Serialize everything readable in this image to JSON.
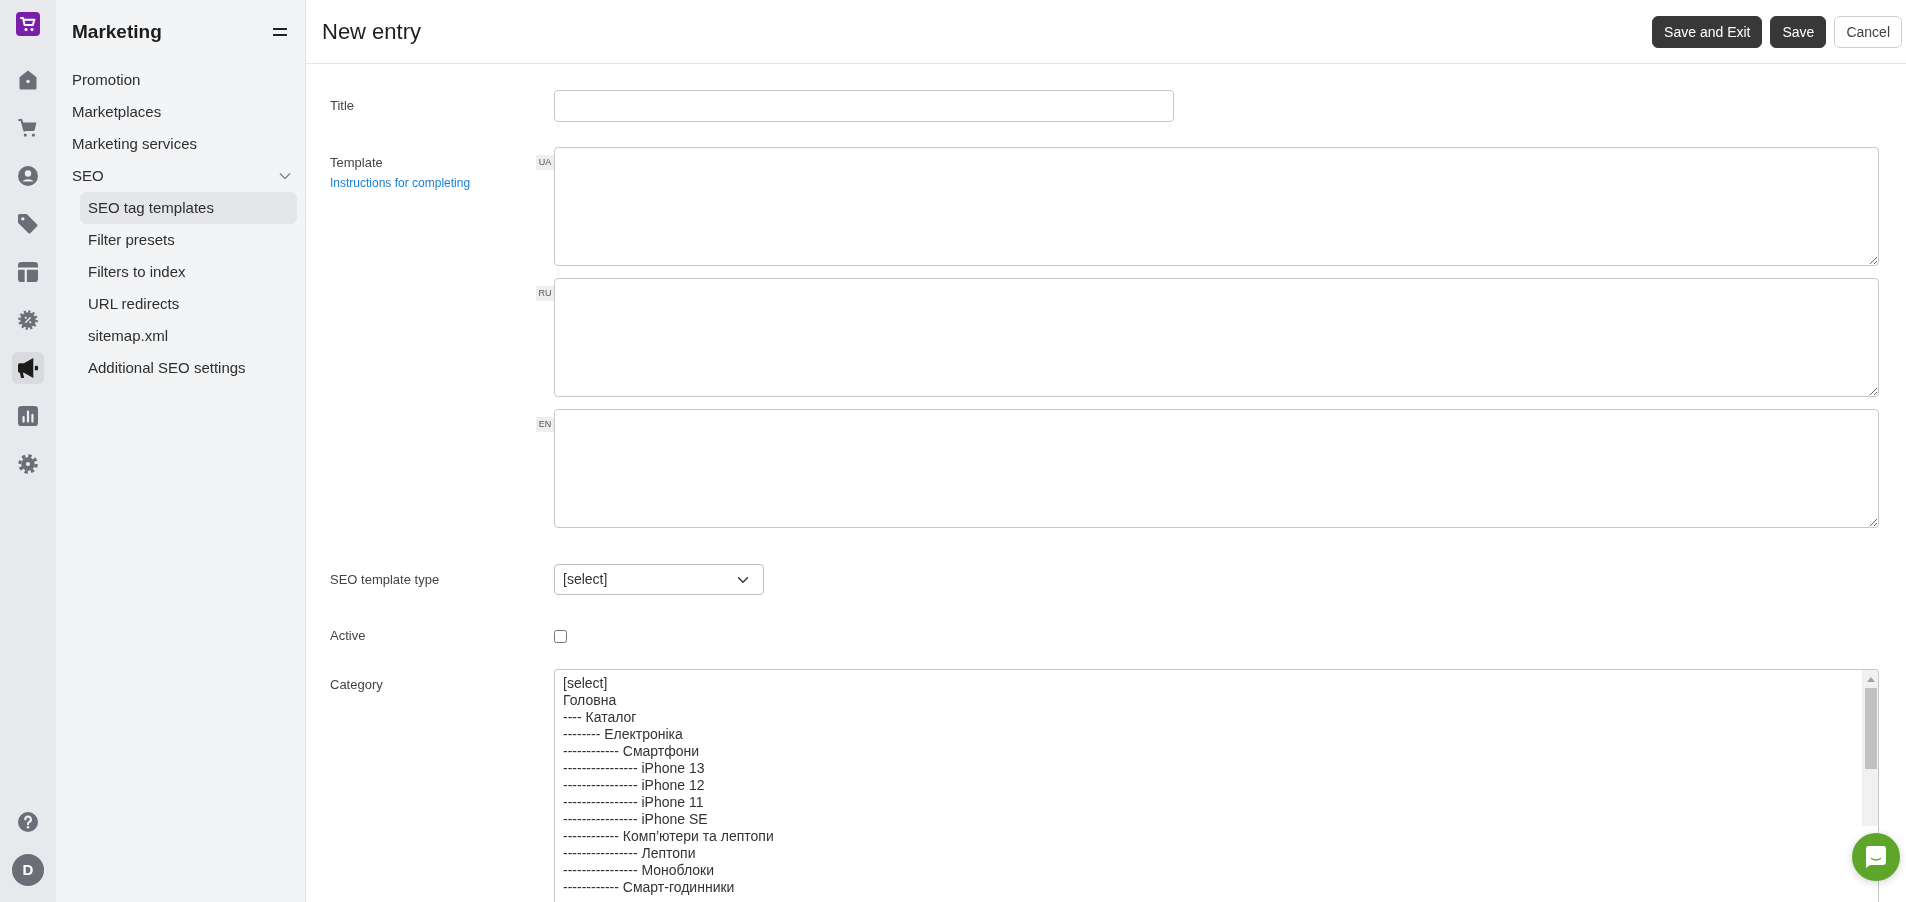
{
  "nav_rail": {
    "items": [
      {
        "selected": false
      },
      {
        "selected": false
      },
      {
        "selected": false
      },
      {
        "selected": false
      },
      {
        "selected": false
      },
      {
        "selected": false
      },
      {
        "selected": true
      },
      {
        "selected": false
      },
      {
        "selected": false
      }
    ],
    "avatar": "D"
  },
  "sidebar": {
    "title": "Marketing",
    "items": [
      {
        "label": "Promotion",
        "selected": false
      },
      {
        "label": "Marketplaces",
        "selected": false
      },
      {
        "label": "Marketing services",
        "selected": false
      },
      {
        "label": "SEO",
        "selected": false,
        "expanded": true,
        "children": [
          {
            "label": "SEO tag templates",
            "selected": true
          },
          {
            "label": "Filter presets",
            "selected": false
          },
          {
            "label": "Filters to index",
            "selected": false
          },
          {
            "label": "URL redirects",
            "selected": false
          },
          {
            "label": "sitemap.xml",
            "selected": false
          },
          {
            "label": "Additional SEO settings",
            "selected": false
          }
        ]
      }
    ]
  },
  "header": {
    "title": "New entry",
    "buttons": [
      {
        "label": "Save and Exit",
        "kind": "primary"
      },
      {
        "label": "Save",
        "kind": "primary"
      },
      {
        "label": "Cancel",
        "kind": "secondary"
      }
    ]
  },
  "form": {
    "fields": [
      {
        "kind": "text",
        "label": "Title"
      },
      {
        "kind": "multilang",
        "label": "Template",
        "link": "Instructions for completing",
        "languages": [
          "UA",
          "RU",
          "EN"
        ]
      },
      {
        "kind": "select",
        "label": "SEO template type",
        "value": "[select]"
      },
      {
        "kind": "checkbox",
        "label": "Active",
        "checked": false
      },
      {
        "kind": "listbox",
        "label": "Category",
        "options": [
          {
            "label": "[select]",
            "selected": false
          },
          {
            "label": "Головна",
            "selected": false
          },
          {
            "label": "---- Каталог",
            "selected": false
          },
          {
            "label": "-------- Електроніка",
            "selected": false
          },
          {
            "label": "------------ Смартфони",
            "selected": false
          },
          {
            "label": "---------------- iPhone 13",
            "selected": false
          },
          {
            "label": "---------------- iPhone 12",
            "selected": false
          },
          {
            "label": "---------------- iPhone 11",
            "selected": false
          },
          {
            "label": "---------------- iPhone SE",
            "selected": false
          },
          {
            "label": "------------ Комп’ютери та лептопи",
            "selected": false
          },
          {
            "label": "---------------- Лептопи",
            "selected": false
          },
          {
            "label": "---------------- Моноблоки",
            "selected": false
          },
          {
            "label": "------------ Смарт-годинники",
            "selected": false
          }
        ]
      }
    ]
  }
}
